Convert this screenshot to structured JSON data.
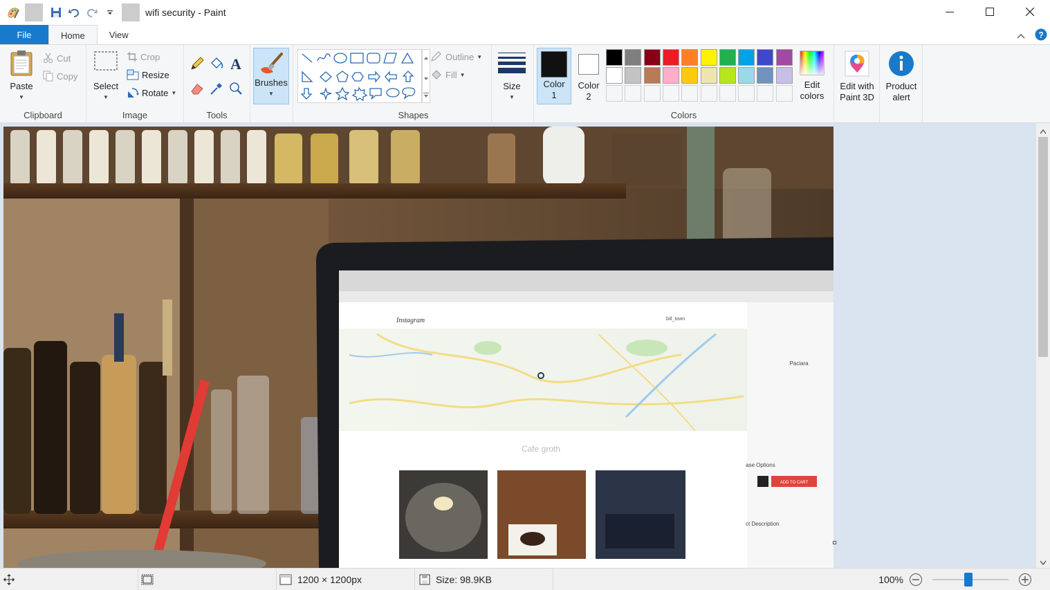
{
  "window": {
    "title": "wifi security - Paint"
  },
  "tabs": {
    "file": "File",
    "home": "Home",
    "view": "View"
  },
  "clipboard": {
    "paste": "Paste",
    "cut": "Cut",
    "copy": "Copy",
    "label": "Clipboard"
  },
  "image": {
    "select": "Select",
    "crop": "Crop",
    "resize": "Resize",
    "rotate": "Rotate",
    "label": "Image"
  },
  "tools": {
    "label": "Tools"
  },
  "brushes": {
    "label": "Brushes"
  },
  "shapes": {
    "outline": "Outline",
    "fill": "Fill",
    "label": "Shapes"
  },
  "size": {
    "label": "Size"
  },
  "colors": {
    "color1": "Color",
    "color1_num": "1",
    "color2": "Color",
    "color2_num": "2",
    "label": "Colors",
    "edit_line1": "Edit",
    "edit_line2": "colors",
    "color1_value": "#111111",
    "color2_value": "#ffffff",
    "palette_row1": [
      "#000000",
      "#7f7f7f",
      "#880015",
      "#ed1c24",
      "#ff7f27",
      "#fff200",
      "#22b14c",
      "#00a2e8",
      "#3f48cc",
      "#a349a4"
    ],
    "palette_row2": [
      "#ffffff",
      "#c3c3c3",
      "#b97a57",
      "#ffaec9",
      "#ffc90e",
      "#efe4b0",
      "#b5e61d",
      "#99d9ea",
      "#7092be",
      "#c8bfe7"
    ]
  },
  "extras": {
    "paint3d_line1": "Edit with",
    "paint3d_line2": "Paint 3D",
    "alert_line1": "Product",
    "alert_line2": "alert"
  },
  "status": {
    "dimensions": "1200 × 1200px",
    "size": "Size: 98.9KB",
    "zoom": "100%"
  },
  "photo": {
    "laptop_app": "Instagram",
    "laptop_user": "bill_town",
    "laptop_heading": "Cafe groth",
    "side_title": "Paciara",
    "side_button": "ADD TO CART",
    "side_options": "ase Options",
    "side_desc": "ct Description"
  }
}
